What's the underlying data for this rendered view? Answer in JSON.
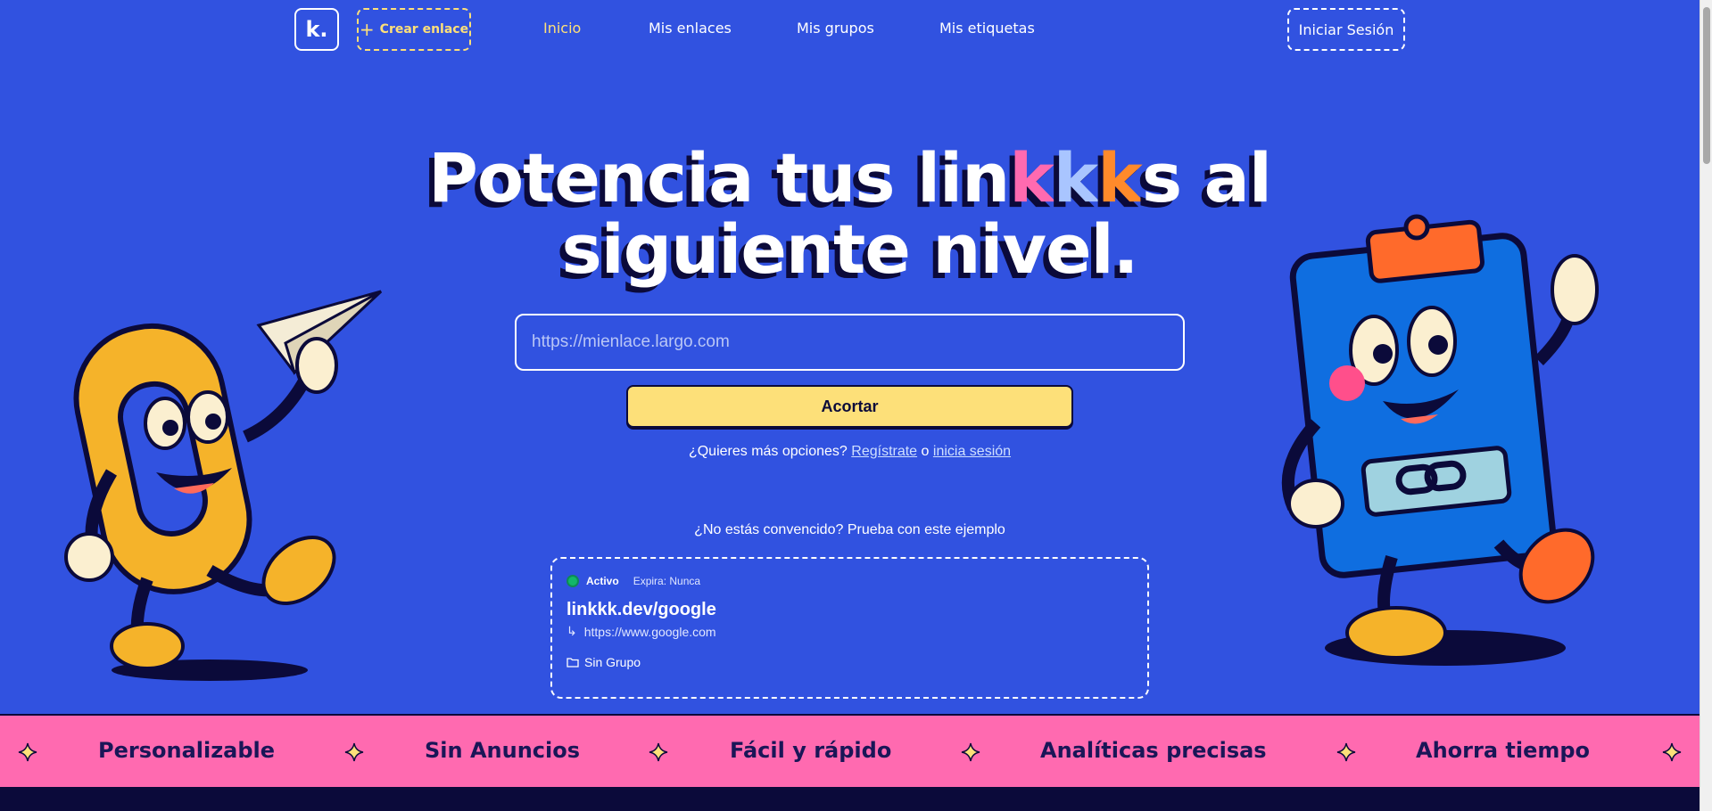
{
  "nav": {
    "logo": "k.",
    "create_label": "Crear enlace",
    "links": [
      "Inicio",
      "Mis enlaces",
      "Mis grupos",
      "Mis etiquetas"
    ],
    "login_label": "Iniciar Sesión"
  },
  "hero": {
    "title_part1": "Potencia tus lin",
    "k1": "k",
    "k2": "k",
    "k3": "k",
    "title_part2": "s al",
    "title_line2": "siguiente nivel."
  },
  "form": {
    "placeholder": "https://mienlace.largo.com",
    "button_label": "Acortar",
    "more_text": "¿Quieres más opciones?",
    "register_link": "Regístrate",
    "or_text": "o",
    "login_link": "inicia sesión"
  },
  "example": {
    "question": "¿No estás convencido? Prueba con este ejemplo",
    "status": "Activo",
    "expires": "Expira: Nunca",
    "short_url": "linkkk.dev/google",
    "destination": "https://www.google.com",
    "group": "Sin Grupo"
  },
  "marquee": [
    "Personalizable",
    "Sin Anuncios",
    "Fácil y rápido",
    "Analíticas precisas",
    "Ahorra tiempo"
  ],
  "colors": {
    "background": "#3152e0",
    "accent_yellow": "#fde079",
    "pink": "#ff6ab0",
    "dark": "#0b0a3a"
  }
}
